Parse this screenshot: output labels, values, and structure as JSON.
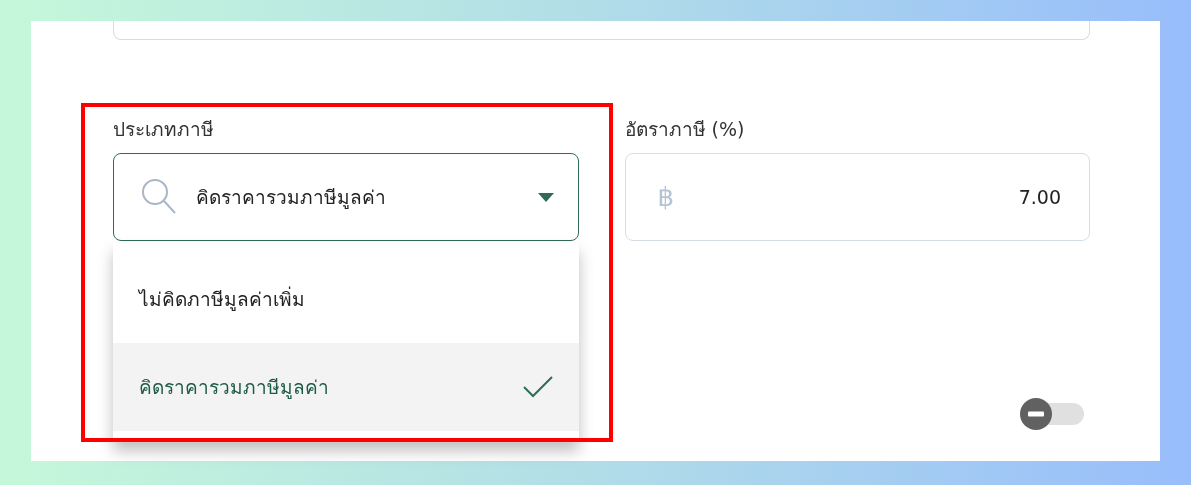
{
  "tax_type": {
    "label": "ประเภทภาษี",
    "value": "คิดราคารวมภาษีมูลค่า",
    "expanded": true,
    "highlighted": true,
    "options": [
      {
        "label": "ไม่คิดภาษีมูลค่าเพิ่ม",
        "selected": false
      },
      {
        "label": "คิดราคารวมภาษีมูลค่า",
        "selected": true
      }
    ]
  },
  "tax_rate": {
    "label": "อัตราภาษี (%)",
    "currency": "฿",
    "value": "7.00"
  },
  "toggle": {
    "on": false
  }
}
